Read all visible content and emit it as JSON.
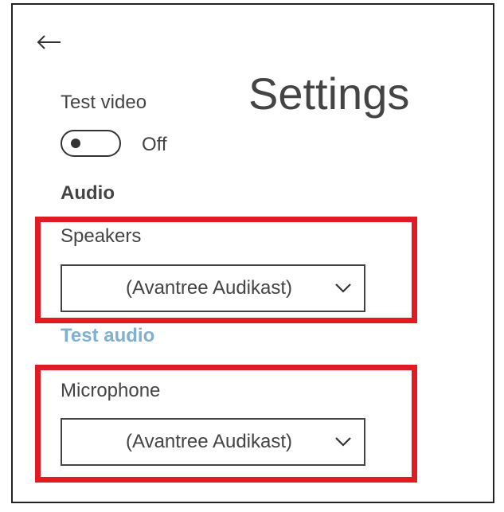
{
  "header": {
    "title": "Settings",
    "back_icon": "back-arrow-icon"
  },
  "video": {
    "label": "Test video",
    "toggle_state": "Off",
    "toggle_on": false
  },
  "audio": {
    "heading": "Audio",
    "speakers": {
      "label": "Speakers",
      "selected": "(Avantree Audikast)"
    },
    "test_audio_link": "Test audio",
    "microphone": {
      "label": "Microphone",
      "selected": "(Avantree Audikast)"
    }
  },
  "colors": {
    "highlight": "#e01b24",
    "link": "#7fb0cf",
    "text": "#444444"
  }
}
